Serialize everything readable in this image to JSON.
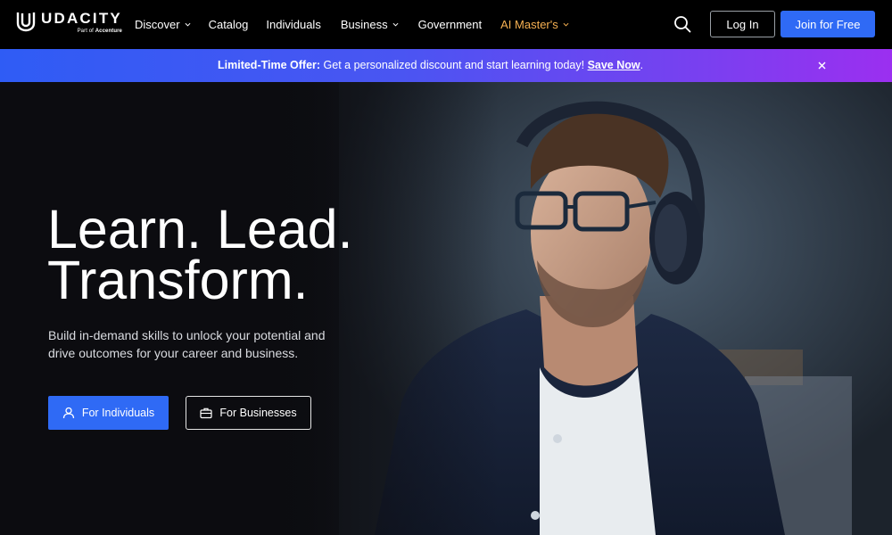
{
  "brand": {
    "name": "UDACITY",
    "tagline_prefix": "Part of",
    "tagline_company": "Accenture"
  },
  "nav": {
    "items": [
      {
        "label": "Discover",
        "has_dropdown": true
      },
      {
        "label": "Catalog",
        "has_dropdown": false
      },
      {
        "label": "Individuals",
        "has_dropdown": false
      },
      {
        "label": "Business",
        "has_dropdown": true
      },
      {
        "label": "Government",
        "has_dropdown": false
      },
      {
        "label": "AI Master's",
        "has_dropdown": true
      }
    ],
    "search_icon": "search-icon",
    "login_label": "Log In",
    "join_label": "Join for Free"
  },
  "banner": {
    "lead": "Limited-Time Offer:",
    "message": " Get a personalized discount and start learning today! ",
    "cta": "Save Now",
    "trailing": ".",
    "close_icon": "close-icon"
  },
  "hero": {
    "headline_line1": "Learn. Lead.",
    "headline_line2": "Transform.",
    "subtext": "Build in-demand skills to unlock your potential and drive outcomes for your career and business.",
    "primary_cta": "For Individuals",
    "secondary_cta": "For Businesses",
    "primary_icon": "user-icon",
    "secondary_icon": "briefcase-icon",
    "image": "man-with-headphones-photo"
  },
  "colors": {
    "nav_bg": "#000000",
    "primary_blue": "#2f6af5",
    "accent_orange": "#f7b152",
    "banner_gradient_start": "#2f5cf5",
    "banner_gradient_end": "#9b2ff0",
    "hero_bg": "#0c0c10"
  }
}
